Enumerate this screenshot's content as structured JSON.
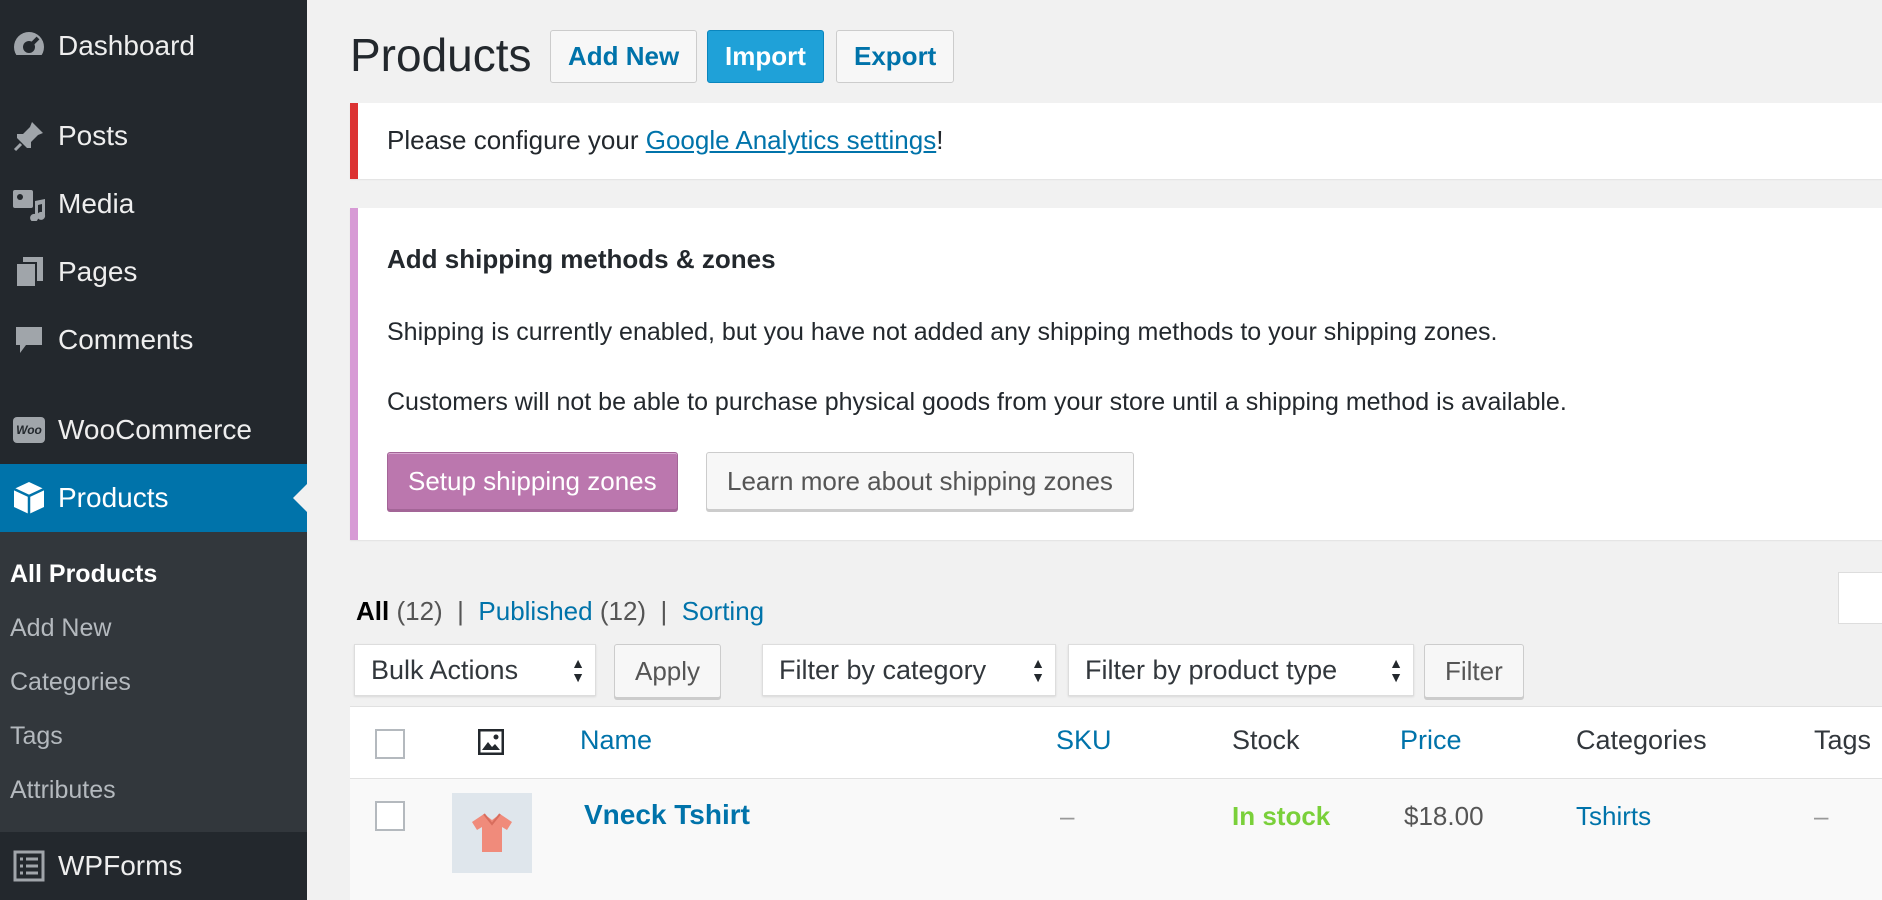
{
  "sidebar": {
    "items": [
      {
        "label": "Dashboard",
        "icon": "dashboard-icon"
      },
      {
        "label": "Posts",
        "icon": "pin-icon"
      },
      {
        "label": "Media",
        "icon": "media-icon"
      },
      {
        "label": "Pages",
        "icon": "pages-icon"
      },
      {
        "label": "Comments",
        "icon": "comment-icon"
      },
      {
        "label": "WooCommerce",
        "icon": "woo-icon"
      },
      {
        "label": "Products",
        "icon": "cube-icon"
      },
      {
        "label": "WPForms",
        "icon": "forms-icon"
      }
    ],
    "woo_badge": "Woo",
    "submenu": [
      "All Products",
      "Add New",
      "Categories",
      "Tags",
      "Attributes"
    ],
    "current": "Products",
    "current_sub": "All Products"
  },
  "header": {
    "title": "Products",
    "add_new": "Add New",
    "import": "Import",
    "export": "Export"
  },
  "notice_ga": {
    "prefix": "Please configure your ",
    "link": "Google Analytics settings",
    "suffix": "!"
  },
  "notice_shipping": {
    "title": "Add shipping methods & zones",
    "line1": "Shipping is currently enabled, but you have not added any shipping methods to your shipping zones.",
    "line2": "Customers will not be able to purchase physical goods from your store until a shipping method is available.",
    "setup_button": "Setup shipping zones",
    "learn_button": "Learn more about shipping zones"
  },
  "views": {
    "all": "All",
    "all_count": "(12)",
    "published": "Published",
    "published_count": "(12)",
    "sorting": "Sorting",
    "separator": "|"
  },
  "filters": {
    "bulk_actions": "Bulk Actions",
    "apply": "Apply",
    "category": "Filter by category",
    "product_type": "Filter by product type",
    "filter": "Filter"
  },
  "table": {
    "columns": [
      "Name",
      "SKU",
      "Stock",
      "Price",
      "Categories",
      "Tags"
    ],
    "rows": [
      {
        "name": "Vneck Tshirt",
        "sku": "–",
        "stock": "In stock",
        "price": "$18.00",
        "categories": "Tshirts",
        "tags": "–"
      }
    ]
  },
  "colors": {
    "sidebar_bg": "#23282d",
    "accent": "#0073aa",
    "error": "#dc3232",
    "woo_purple": "#bb77ae",
    "in_stock": "#7ad03a"
  }
}
